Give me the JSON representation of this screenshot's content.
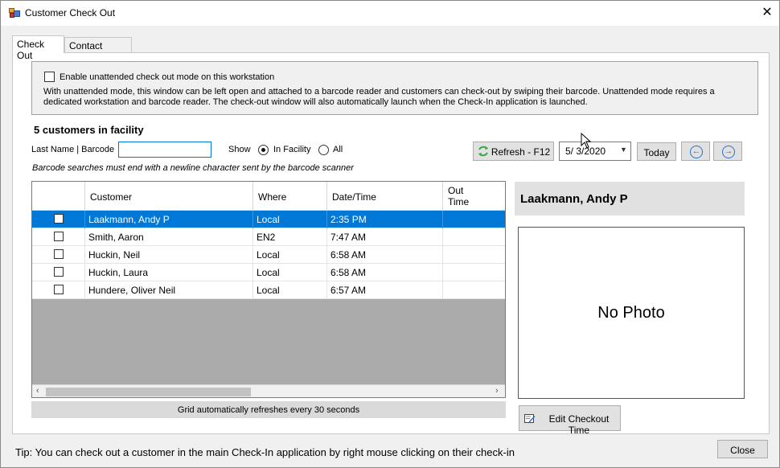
{
  "window": {
    "title": "Customer Check Out"
  },
  "tabs": [
    {
      "label": "Check Out"
    },
    {
      "label": "Contact Tracing"
    }
  ],
  "unattended": {
    "label": "Enable unattended check out mode on this workstation",
    "checked": false,
    "description": "With unattended mode, this window can be left open and attached to a barcode reader and customers can check-out by swiping their barcode.  Unattended mode requires a dedicated workstation and barcode reader.  The check-out window will also automatically launch when the Check-In application is launched."
  },
  "summary": {
    "count_text": "5 customers in facility"
  },
  "search": {
    "label": "Last Name | Barcode",
    "value": ""
  },
  "show": {
    "label": "Show",
    "options": [
      "In Facility",
      "All"
    ],
    "selected": "In Facility"
  },
  "barcode_hint": "Barcode searches must end with a newline character sent by the barcode scanner",
  "toolbar": {
    "refresh_label": "Refresh - F12",
    "date_value": "5/  3/2020",
    "today_label": "Today"
  },
  "grid": {
    "headers": [
      "",
      "Customer",
      "Where",
      "Date/Time",
      "Out Time"
    ],
    "rows": [
      {
        "customer": "Laakmann, Andy P",
        "where": "Local",
        "datetime": "2:35 PM",
        "out_time": "",
        "selected": true
      },
      {
        "customer": "Smith, Aaron",
        "where": "EN2",
        "datetime": "7:47 AM",
        "out_time": "",
        "selected": false
      },
      {
        "customer": "Huckin, Neil",
        "where": "Local",
        "datetime": "6:58 AM",
        "out_time": "",
        "selected": false
      },
      {
        "customer": "Huckin, Laura",
        "where": "Local",
        "datetime": "6:58 AM",
        "out_time": "",
        "selected": false
      },
      {
        "customer": "Hundere, Oliver Neil",
        "where": "Local",
        "datetime": "6:57 AM",
        "out_time": "",
        "selected": false
      }
    ],
    "footer": "Grid automatically refreshes every 30 seconds"
  },
  "detail": {
    "name": "Laakmann, Andy P",
    "photo_text": "No Photo",
    "edit_label": "Edit Checkout Time"
  },
  "footer": {
    "tip": "Tip:  You can check out a customer in the main Check-In application by right mouse clicking on their check-in",
    "close_label": "Close"
  },
  "colors": {
    "selection": "#0078d7",
    "accent_icon": "#2c6fd1",
    "refresh_icon": "#3aa64a"
  },
  "icons": [
    "app-icon",
    "close-icon",
    "refresh-icon",
    "chevron-down-icon",
    "arrow-left-icon",
    "arrow-right-icon",
    "edit-icon"
  ]
}
